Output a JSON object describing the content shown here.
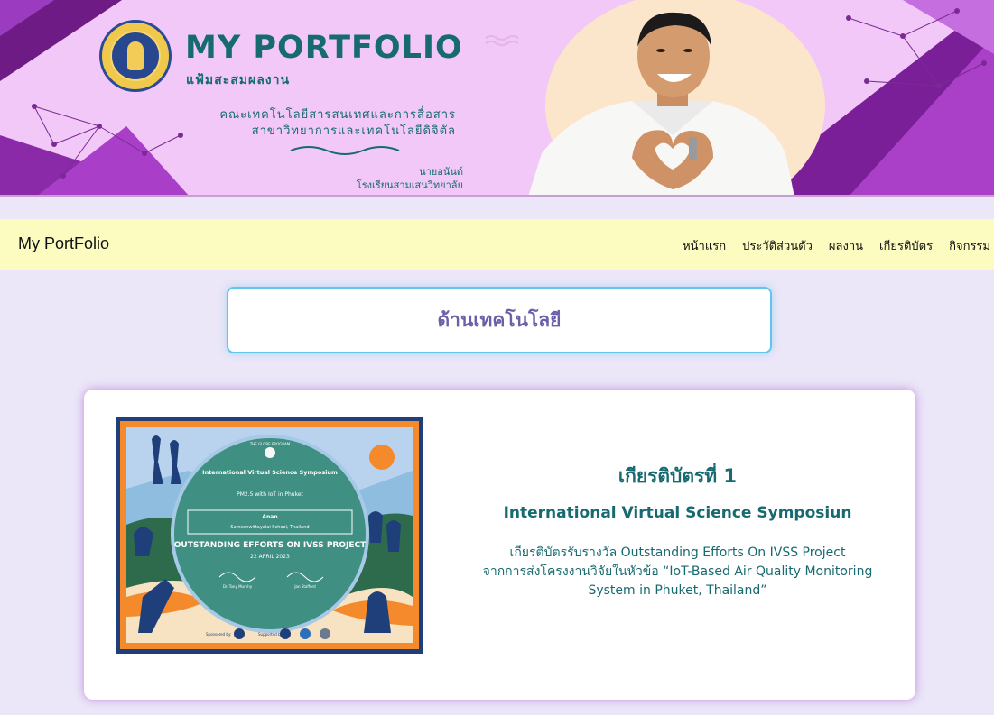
{
  "banner": {
    "title": "MY PORTFOLIO",
    "subtitle": "แฟ้มสะสมผลงาน",
    "line1": "คณะเทคโนโลยีสารสนเทศและการสื่อสาร",
    "line2": "สาขาวิทยาการและเทคโนโลยีดิจิตัล",
    "name": "นายอนันต์",
    "school": "โรงเรียนสามเสนวิทยาลัย"
  },
  "navbar": {
    "brand": "My PortFolio",
    "links": [
      "หน้าแรก",
      "ประวัติส่วนตัว",
      "ผลงาน",
      "เกียรติบัตร",
      "กิจกรรม"
    ]
  },
  "section": {
    "title": "ด้านเทคโนโลยี"
  },
  "card": {
    "heading": "เกียรติบัตรที่ 1",
    "subheading": "International Virtual Science Symposiun",
    "desc_line1": "เกียรติบัตรรับรางวัล Outstanding Efforts On IVSS Project",
    "desc_line2": "จากการส่งโครงงานวิจัยในหัวข้อ “IoT-Based Air Quality Monitoring",
    "desc_line3": "System in Phuket, Thailand”"
  },
  "certificate": {
    "org": "THE GLOBE PROGRAM",
    "event": "International Virtual Science Symposium",
    "project": "PM2.5 with IoT in Phuket",
    "recipient": "Anan",
    "school": "Samsenwittayalai School, Thailand",
    "award": "OUTSTANDING EFFORTS ON IVSS PROJECT",
    "date": "22 APRIL 2023",
    "signer1": "Dr. Tony Murphy",
    "signer2": "Jan Stafford",
    "sponsored": "Sponsored by:",
    "supported": "Supported by:"
  },
  "colors": {
    "banner_bg": "#f1c8f7",
    "accent_teal": "#176a6f",
    "navbar_bg": "#fcfbc0",
    "page_bg": "#ebe6f8",
    "section_border": "#61c6ee",
    "section_title": "#6b5fa5"
  }
}
